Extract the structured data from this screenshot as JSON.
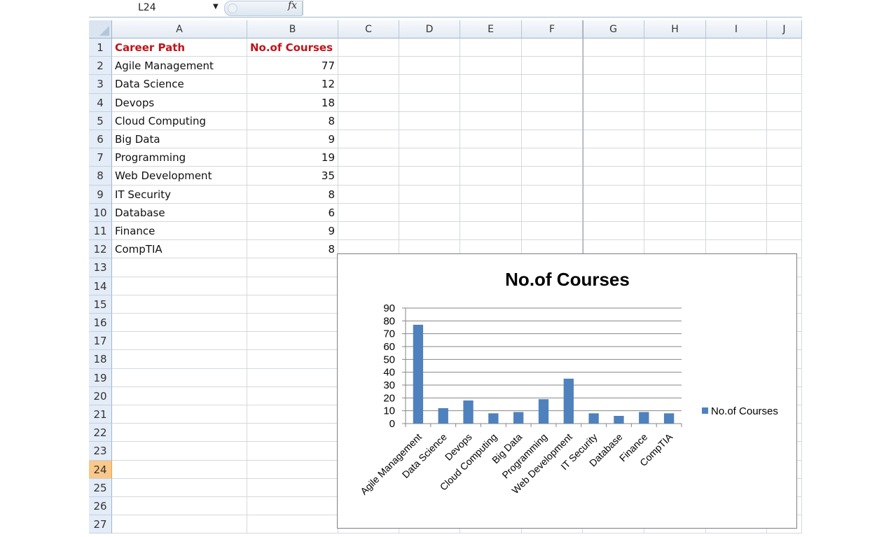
{
  "formula_bar": {
    "name_box": "L24",
    "fx_label": "fx",
    "formula": ""
  },
  "columns": [
    "A",
    "B",
    "C",
    "D",
    "E",
    "F",
    "G",
    "H",
    "I",
    "J"
  ],
  "rows": [
    "1",
    "2",
    "3",
    "4",
    "5",
    "6",
    "7",
    "8",
    "9",
    "10",
    "11",
    "12",
    "13",
    "14",
    "15",
    "16",
    "17",
    "18",
    "19",
    "20",
    "21",
    "22",
    "23",
    "24",
    "25",
    "26",
    "27"
  ],
  "selected_row": "24",
  "table": {
    "headers": [
      "Career Path",
      "No.of Courses"
    ],
    "rows": [
      [
        "Agile Management",
        "77"
      ],
      [
        "Data Science",
        "12"
      ],
      [
        "Devops",
        "18"
      ],
      [
        "Cloud Computing",
        "8"
      ],
      [
        "Big Data",
        "9"
      ],
      [
        "Programming",
        "19"
      ],
      [
        "Web Development",
        "35"
      ],
      [
        "IT Security",
        "8"
      ],
      [
        "Database",
        "6"
      ],
      [
        "Finance",
        "9"
      ],
      [
        "CompTIA",
        "8"
      ]
    ]
  },
  "colors": {
    "bar": "#4f81bd",
    "header_text": "#c0141a"
  },
  "chart_data": {
    "type": "bar",
    "title": "No.of Courses",
    "categories": [
      "Agile Management",
      "Data Science",
      "Devops",
      "Cloud Computing",
      "Big Data",
      "Programming",
      "Web Development",
      "IT Security",
      "Database",
      "Finance",
      "CompTIA"
    ],
    "series": [
      {
        "name": "No.of Courses",
        "values": [
          77,
          12,
          18,
          8,
          9,
          19,
          35,
          8,
          6,
          9,
          8
        ]
      }
    ],
    "xlabel": "",
    "ylabel": "",
    "ylim": [
      0,
      90
    ],
    "yticks": [
      0,
      10,
      20,
      30,
      40,
      50,
      60,
      70,
      80,
      90
    ],
    "grid": true,
    "legend": "right"
  }
}
